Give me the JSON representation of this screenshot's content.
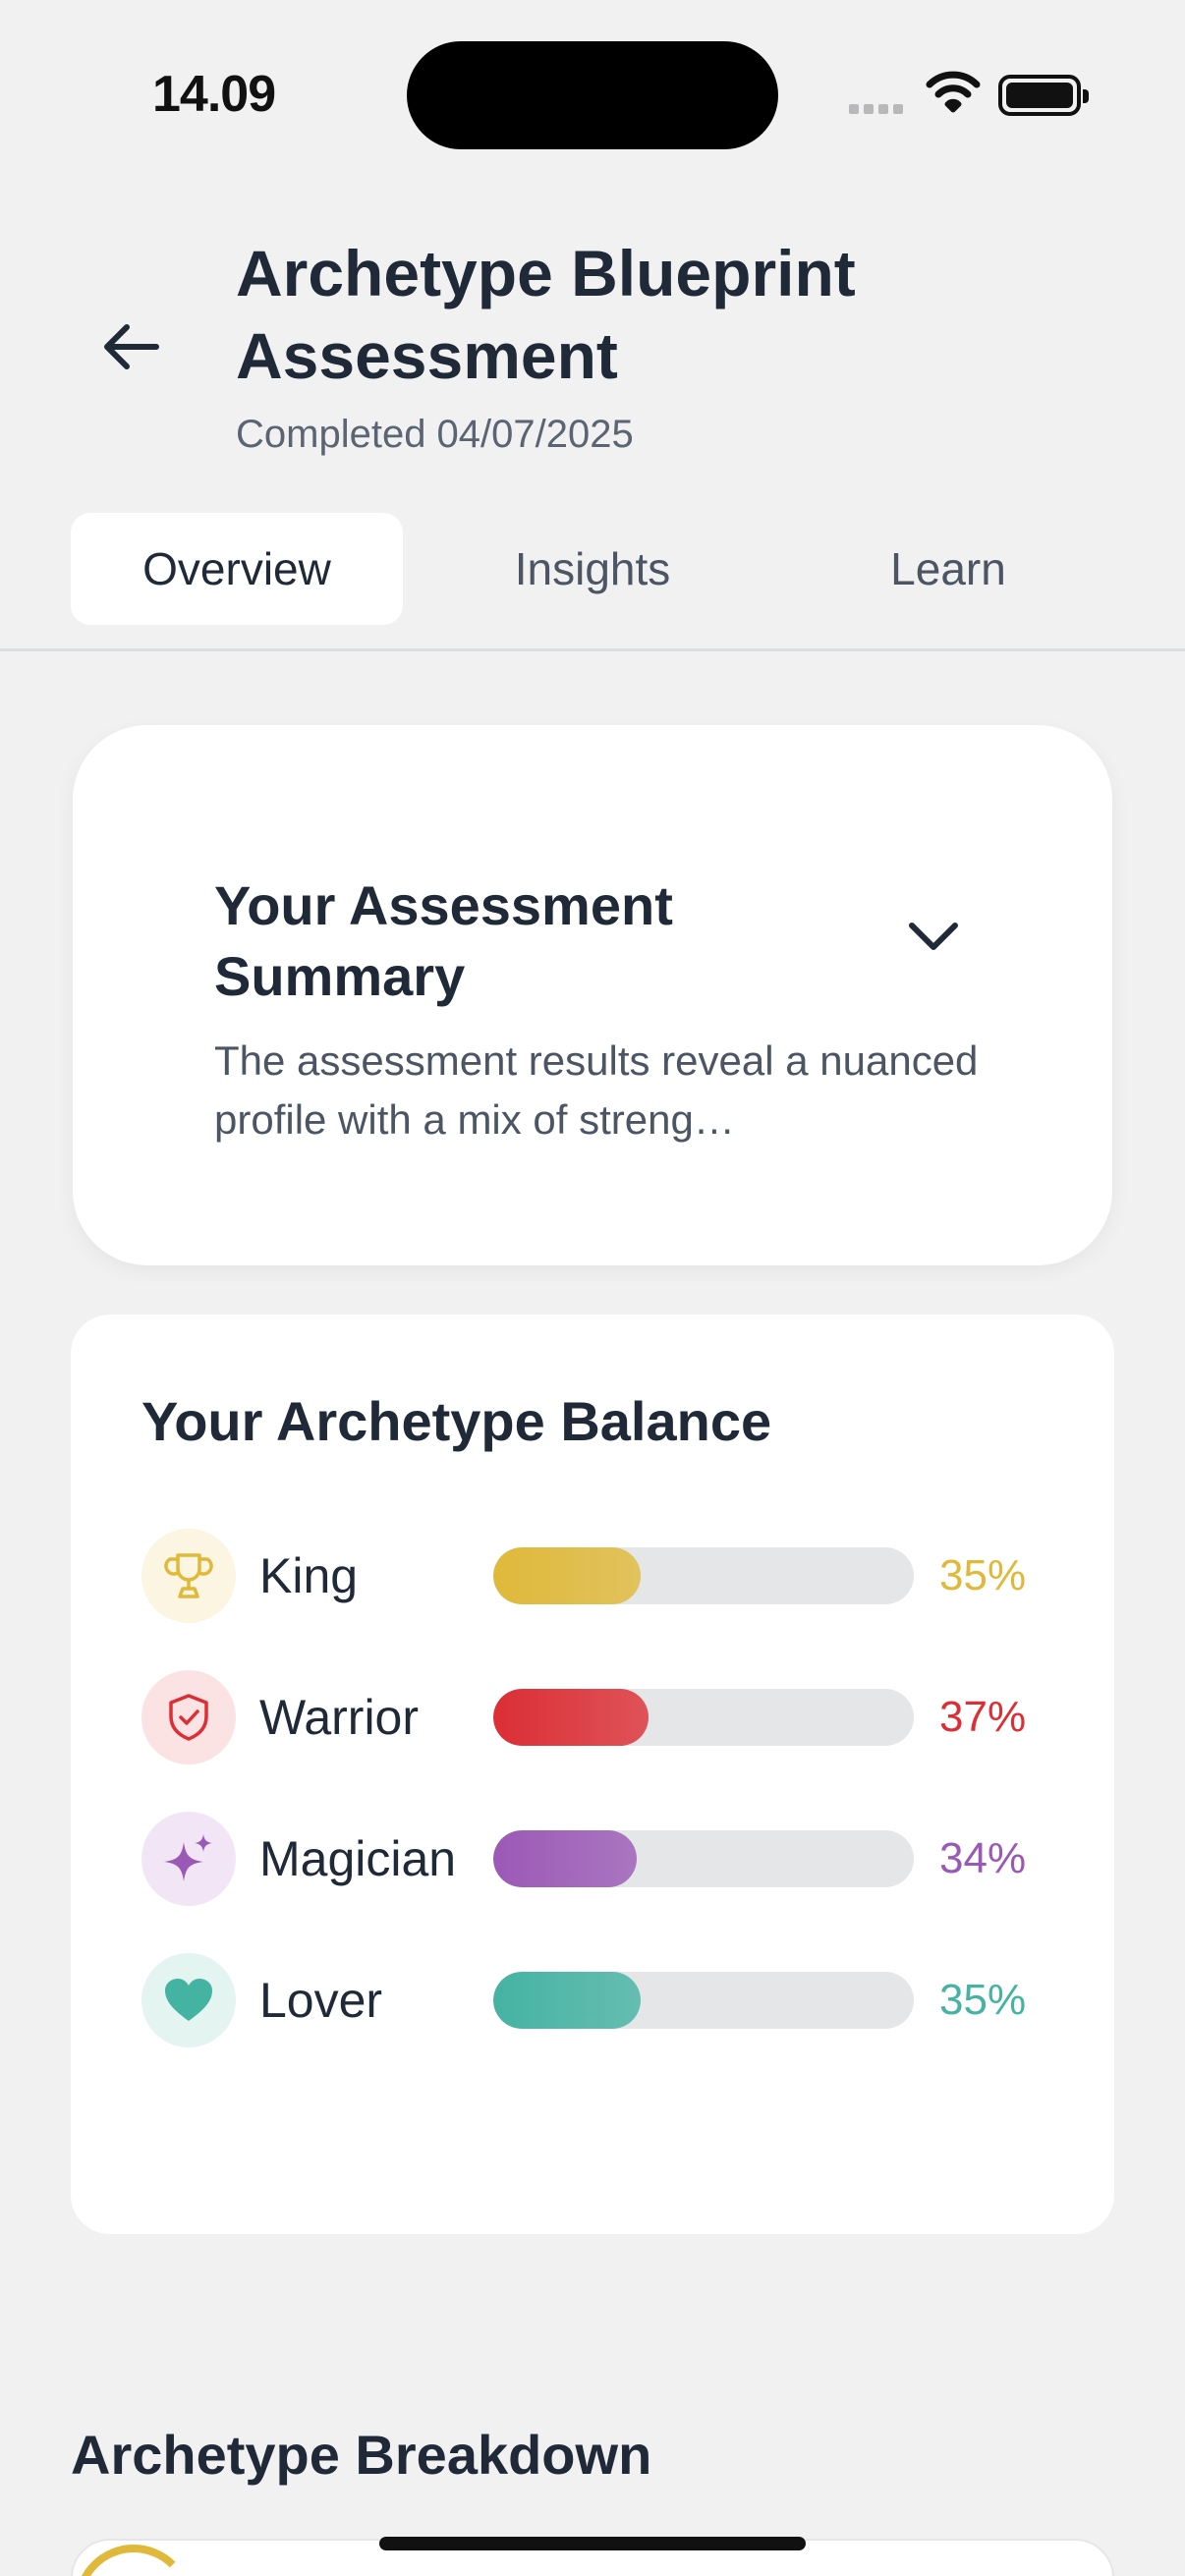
{
  "status": {
    "time": "14.09"
  },
  "header": {
    "title": "Archetype Blueprint Assessment",
    "subtitle": "Completed 04/07/2025"
  },
  "tabs": [
    {
      "label": "Overview",
      "active": true
    },
    {
      "label": "Insights",
      "active": false
    },
    {
      "label": "Learn",
      "active": false
    }
  ],
  "summary": {
    "title": "Your Assessment Summary",
    "text": "The assessment results reveal a nuanced profile with a mix of streng…"
  },
  "balance": {
    "title": "Your Archetype Balance",
    "items": [
      {
        "label": "King",
        "value": 35,
        "display": "35%",
        "icon": "trophy-icon",
        "color": "#e0b93a",
        "bg": "#fbf5e1"
      },
      {
        "label": "Warrior",
        "value": 37,
        "display": "37%",
        "icon": "shield-check-icon",
        "color": "#dc2e35",
        "bg": "#fbe3e4"
      },
      {
        "label": "Magician",
        "value": 34,
        "display": "34%",
        "icon": "sparkles-icon",
        "color": "#9b59b6",
        "bg": "#f2e6f6"
      },
      {
        "label": "Lover",
        "value": 35,
        "display": "35%",
        "icon": "heart-icon",
        "color": "#45b3a2",
        "bg": "#e3f4f1"
      }
    ]
  },
  "breakdown": {
    "title": "Archetype Breakdown"
  }
}
